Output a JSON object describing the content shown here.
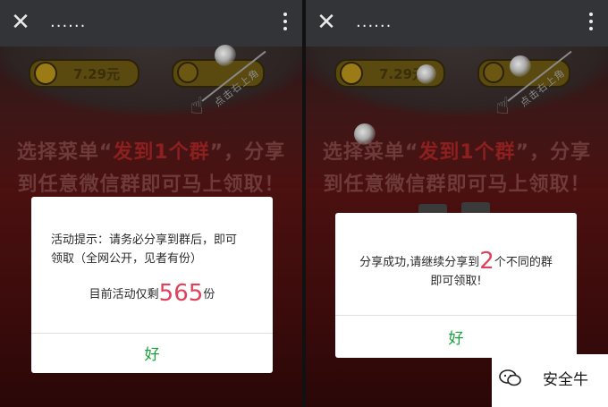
{
  "left": {
    "topbar": {
      "close_icon": "close-icon",
      "title": "......",
      "more_icon": "more-vertical-icon"
    },
    "coin_value": "7.29元",
    "hint": "点击右上角",
    "headline": {
      "line1_prefix": "选择菜单",
      "open_quote": "“",
      "highlight": "发到1个群",
      "close_quote": "”",
      "line1_suffix": "，分享",
      "line2": "到任意微信群即可马上领取！"
    },
    "dialog": {
      "line1": "活动提示：请务必分享到群后，即可",
      "line2": "领取（全网公开，见者有份）",
      "remaining_prefix": "目前活动仅剩",
      "remaining_count": "565",
      "remaining_suffix": "份",
      "ok_label": "好"
    }
  },
  "right": {
    "topbar": {
      "close_icon": "close-icon",
      "title": "......",
      "more_icon": "more-vertical-icon"
    },
    "coin_value": "7.29元",
    "hint": "点击右上角",
    "headline": {
      "line1_prefix": "选择菜单",
      "open_quote": "“",
      "highlight": "发到1个群",
      "close_quote": "”",
      "line1_suffix": "，分享",
      "line2": "到任意微信群即可马上领取！"
    },
    "dialog": {
      "line1_prefix": "分享成功,请继续分享到",
      "group_count": "2",
      "line1_suffix": "个不同的群",
      "line2": "即可领取!",
      "ok_label": "好"
    }
  },
  "watermark": {
    "text": "安全牛",
    "icon": "wechat-icon"
  },
  "colors": {
    "ok_green": "#1aa23a",
    "count_red": "#e0405a",
    "headline_red": "#8e1f1f"
  }
}
